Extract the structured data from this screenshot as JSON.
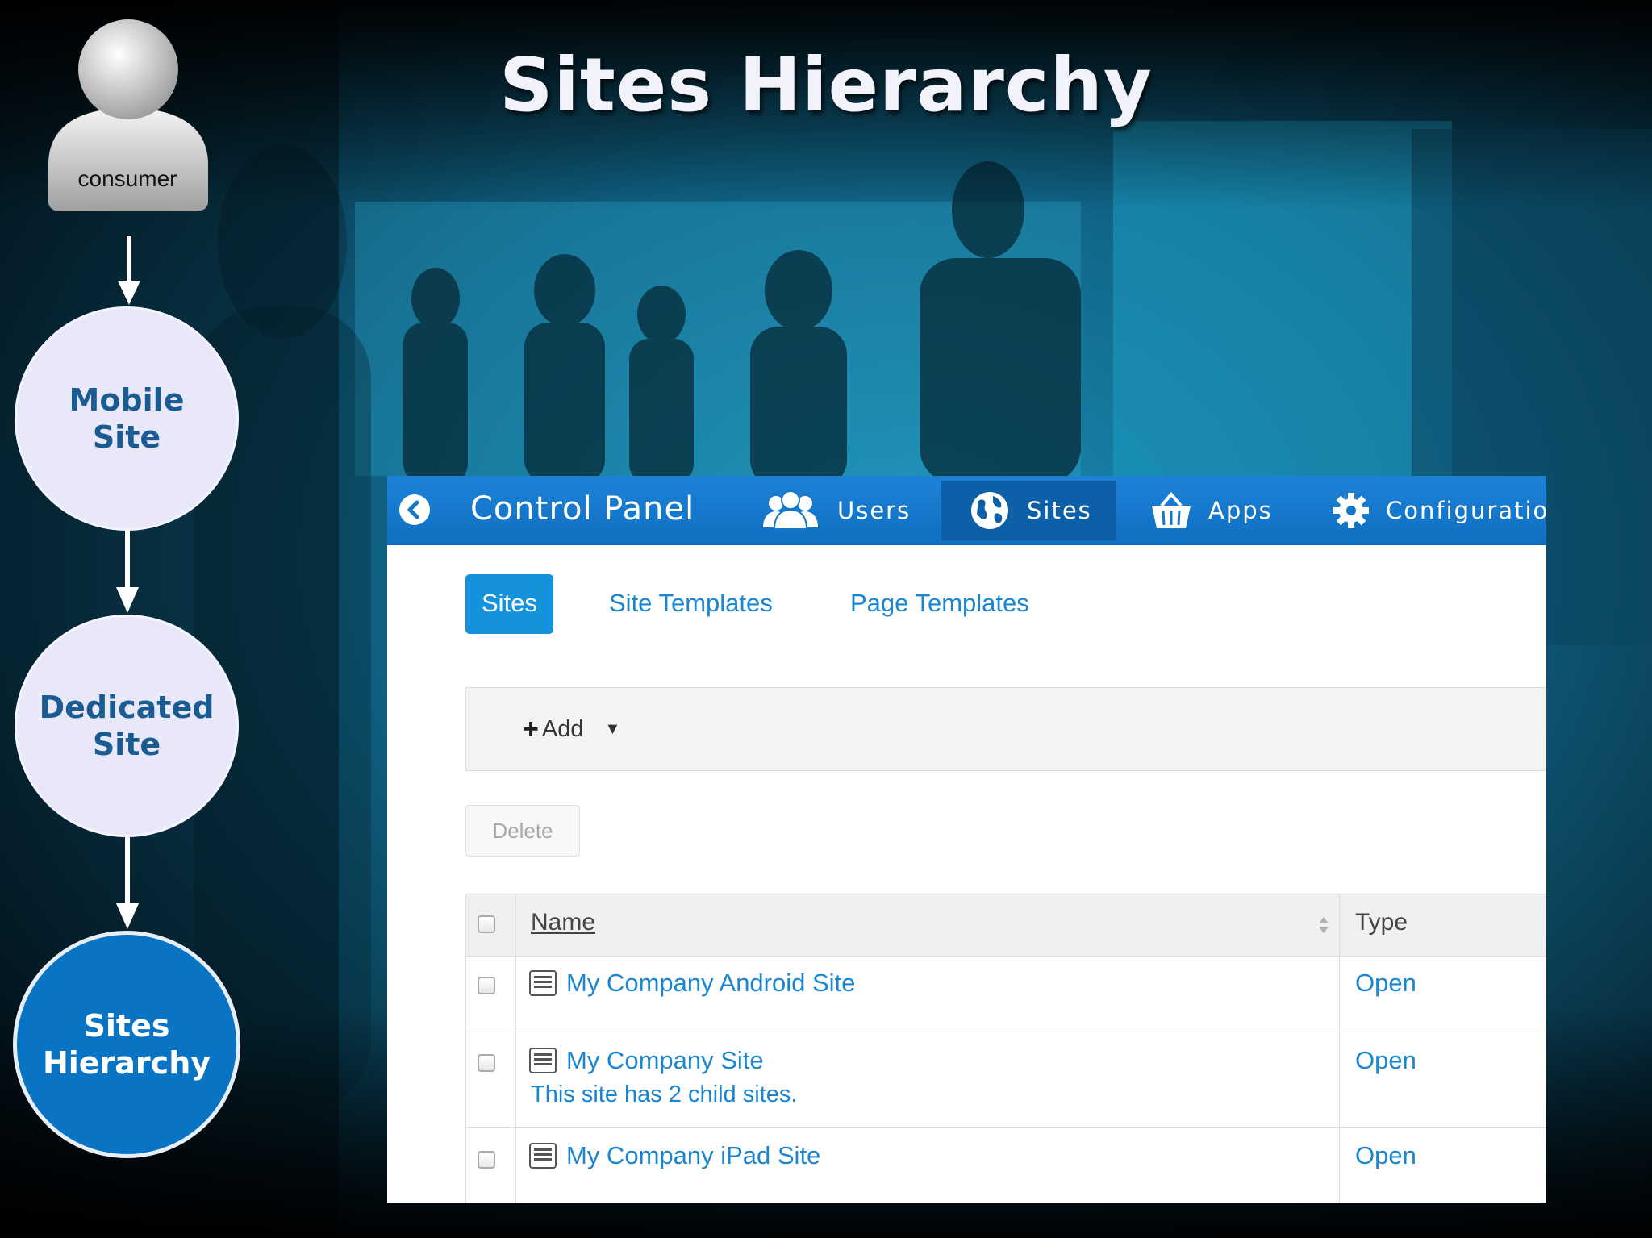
{
  "slide": {
    "title": "Sites Hierarchy"
  },
  "flow": {
    "persona_label": "consumer",
    "nodes": [
      {
        "line1": "Mobile",
        "line2": "Site",
        "state": "inactive"
      },
      {
        "line1": "Dedicated",
        "line2": "Site",
        "state": "inactive"
      },
      {
        "line1": "Sites",
        "line2": "Hierarchy",
        "state": "active"
      }
    ]
  },
  "control_panel": {
    "title": "Control Panel",
    "back_icon": "chevron-left-icon",
    "nav": [
      {
        "label": "Users",
        "icon": "users-icon"
      },
      {
        "label": "Sites",
        "icon": "globe-icon",
        "active": true
      },
      {
        "label": "Apps",
        "icon": "basket-icon"
      },
      {
        "label": "Configuration",
        "icon": "gear-icon"
      }
    ],
    "subtabs": [
      {
        "label": "Sites",
        "active": true
      },
      {
        "label": "Site Templates"
      },
      {
        "label": "Page Templates"
      }
    ],
    "toolbar": {
      "add_label": "Add"
    },
    "delete_label": "Delete",
    "table": {
      "columns": [
        "Name",
        "Type"
      ],
      "rows": [
        {
          "name": "My Company Android Site",
          "note": "",
          "type": "Open"
        },
        {
          "name": "My Company Site",
          "note": "This site has 2 child sites.",
          "type": "Open"
        },
        {
          "name": "My Company iPad Site",
          "note": "",
          "type": "Open"
        }
      ]
    }
  },
  "colors": {
    "accent": "#1a86d0",
    "topbar": "#1378c8",
    "active_node": "#0a74c4",
    "node": "#e8e8f8"
  }
}
